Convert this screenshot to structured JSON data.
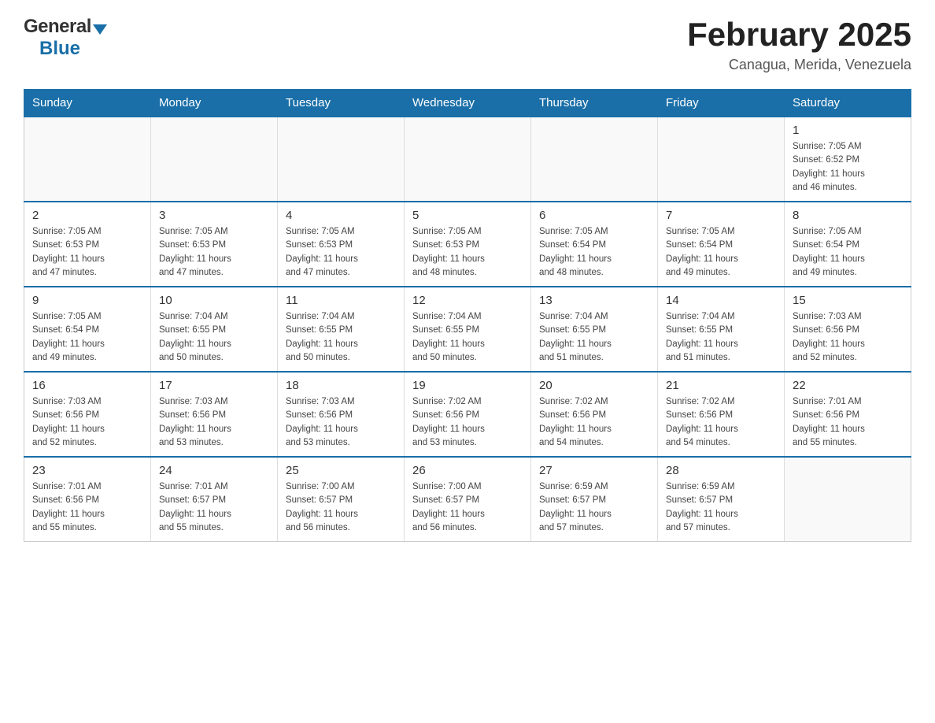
{
  "header": {
    "logo": {
      "general": "General",
      "blue": "Blue"
    },
    "title": "February 2025",
    "location": "Canagua, Merida, Venezuela"
  },
  "calendar": {
    "days_of_week": [
      "Sunday",
      "Monday",
      "Tuesday",
      "Wednesday",
      "Thursday",
      "Friday",
      "Saturday"
    ],
    "weeks": [
      [
        {
          "day": "",
          "info": ""
        },
        {
          "day": "",
          "info": ""
        },
        {
          "day": "",
          "info": ""
        },
        {
          "day": "",
          "info": ""
        },
        {
          "day": "",
          "info": ""
        },
        {
          "day": "",
          "info": ""
        },
        {
          "day": "1",
          "info": "Sunrise: 7:05 AM\nSunset: 6:52 PM\nDaylight: 11 hours\nand 46 minutes."
        }
      ],
      [
        {
          "day": "2",
          "info": "Sunrise: 7:05 AM\nSunset: 6:53 PM\nDaylight: 11 hours\nand 47 minutes."
        },
        {
          "day": "3",
          "info": "Sunrise: 7:05 AM\nSunset: 6:53 PM\nDaylight: 11 hours\nand 47 minutes."
        },
        {
          "day": "4",
          "info": "Sunrise: 7:05 AM\nSunset: 6:53 PM\nDaylight: 11 hours\nand 47 minutes."
        },
        {
          "day": "5",
          "info": "Sunrise: 7:05 AM\nSunset: 6:53 PM\nDaylight: 11 hours\nand 48 minutes."
        },
        {
          "day": "6",
          "info": "Sunrise: 7:05 AM\nSunset: 6:54 PM\nDaylight: 11 hours\nand 48 minutes."
        },
        {
          "day": "7",
          "info": "Sunrise: 7:05 AM\nSunset: 6:54 PM\nDaylight: 11 hours\nand 49 minutes."
        },
        {
          "day": "8",
          "info": "Sunrise: 7:05 AM\nSunset: 6:54 PM\nDaylight: 11 hours\nand 49 minutes."
        }
      ],
      [
        {
          "day": "9",
          "info": "Sunrise: 7:05 AM\nSunset: 6:54 PM\nDaylight: 11 hours\nand 49 minutes."
        },
        {
          "day": "10",
          "info": "Sunrise: 7:04 AM\nSunset: 6:55 PM\nDaylight: 11 hours\nand 50 minutes."
        },
        {
          "day": "11",
          "info": "Sunrise: 7:04 AM\nSunset: 6:55 PM\nDaylight: 11 hours\nand 50 minutes."
        },
        {
          "day": "12",
          "info": "Sunrise: 7:04 AM\nSunset: 6:55 PM\nDaylight: 11 hours\nand 50 minutes."
        },
        {
          "day": "13",
          "info": "Sunrise: 7:04 AM\nSunset: 6:55 PM\nDaylight: 11 hours\nand 51 minutes."
        },
        {
          "day": "14",
          "info": "Sunrise: 7:04 AM\nSunset: 6:55 PM\nDaylight: 11 hours\nand 51 minutes."
        },
        {
          "day": "15",
          "info": "Sunrise: 7:03 AM\nSunset: 6:56 PM\nDaylight: 11 hours\nand 52 minutes."
        }
      ],
      [
        {
          "day": "16",
          "info": "Sunrise: 7:03 AM\nSunset: 6:56 PM\nDaylight: 11 hours\nand 52 minutes."
        },
        {
          "day": "17",
          "info": "Sunrise: 7:03 AM\nSunset: 6:56 PM\nDaylight: 11 hours\nand 53 minutes."
        },
        {
          "day": "18",
          "info": "Sunrise: 7:03 AM\nSunset: 6:56 PM\nDaylight: 11 hours\nand 53 minutes."
        },
        {
          "day": "19",
          "info": "Sunrise: 7:02 AM\nSunset: 6:56 PM\nDaylight: 11 hours\nand 53 minutes."
        },
        {
          "day": "20",
          "info": "Sunrise: 7:02 AM\nSunset: 6:56 PM\nDaylight: 11 hours\nand 54 minutes."
        },
        {
          "day": "21",
          "info": "Sunrise: 7:02 AM\nSunset: 6:56 PM\nDaylight: 11 hours\nand 54 minutes."
        },
        {
          "day": "22",
          "info": "Sunrise: 7:01 AM\nSunset: 6:56 PM\nDaylight: 11 hours\nand 55 minutes."
        }
      ],
      [
        {
          "day": "23",
          "info": "Sunrise: 7:01 AM\nSunset: 6:56 PM\nDaylight: 11 hours\nand 55 minutes."
        },
        {
          "day": "24",
          "info": "Sunrise: 7:01 AM\nSunset: 6:57 PM\nDaylight: 11 hours\nand 55 minutes."
        },
        {
          "day": "25",
          "info": "Sunrise: 7:00 AM\nSunset: 6:57 PM\nDaylight: 11 hours\nand 56 minutes."
        },
        {
          "day": "26",
          "info": "Sunrise: 7:00 AM\nSunset: 6:57 PM\nDaylight: 11 hours\nand 56 minutes."
        },
        {
          "day": "27",
          "info": "Sunrise: 6:59 AM\nSunset: 6:57 PM\nDaylight: 11 hours\nand 57 minutes."
        },
        {
          "day": "28",
          "info": "Sunrise: 6:59 AM\nSunset: 6:57 PM\nDaylight: 11 hours\nand 57 minutes."
        },
        {
          "day": "",
          "info": ""
        }
      ]
    ]
  }
}
